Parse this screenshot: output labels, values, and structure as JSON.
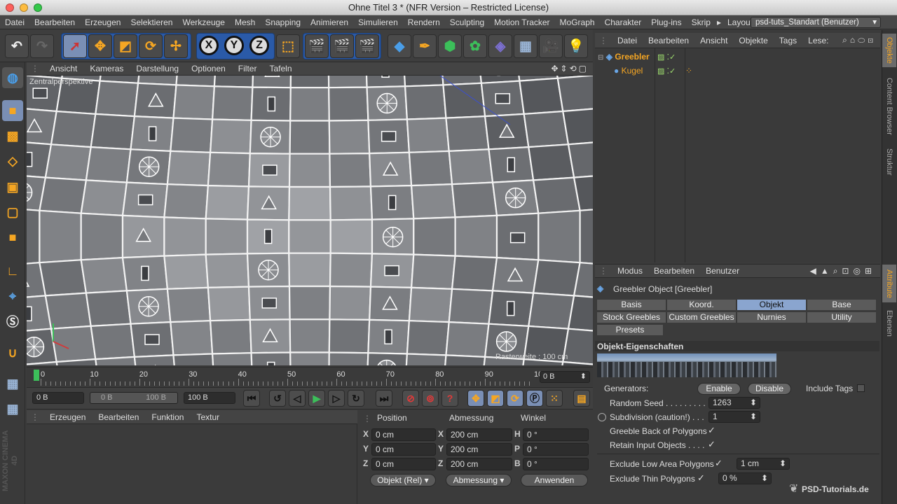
{
  "window": {
    "title": "Ohne Titel 3 * (NFR Version – Restricted License)"
  },
  "menu": [
    "Datei",
    "Bearbeiten",
    "Erzeugen",
    "Selektieren",
    "Werkzeuge",
    "Mesh",
    "Snapping",
    "Animieren",
    "Simulieren",
    "Rendern",
    "Sculpting",
    "Motion Tracker",
    "MoGraph",
    "Charakter",
    "Plug-ins",
    "Skrip"
  ],
  "layout": {
    "label": "Layout:",
    "value": "psd-tuts_Standart (Benutzer)"
  },
  "toolbar": {
    "x": "X",
    "y": "Y",
    "z": "Z"
  },
  "viewport": {
    "menu": [
      "Ansicht",
      "Kameras",
      "Darstellung",
      "Optionen",
      "Filter",
      "Tafeln"
    ],
    "camera": "Zentralperspektive",
    "raster": "Rasterweite : 100 cm"
  },
  "timeline": {
    "ticks": [
      "0",
      "10",
      "20",
      "30",
      "40",
      "50",
      "60",
      "70",
      "80",
      "90",
      "100"
    ],
    "current_frame": "0 B"
  },
  "transport": {
    "start": "0 B",
    "range_start": "0 B",
    "range_end": "100 B",
    "end": "100 B"
  },
  "material_panel": {
    "menu": [
      "Erzeugen",
      "Bearbeiten",
      "Funktion",
      "Textur"
    ]
  },
  "coords": {
    "headers": [
      "Position",
      "Abmessung",
      "Winkel"
    ],
    "rows": [
      {
        "a": "X",
        "pos": "0 cm",
        "b": "X",
        "size": "200 cm",
        "c": "H",
        "rot": "0 °"
      },
      {
        "a": "Y",
        "pos": "0 cm",
        "b": "Y",
        "size": "200 cm",
        "c": "P",
        "rot": "0 °"
      },
      {
        "a": "Z",
        "pos": "0 cm",
        "b": "Z",
        "size": "200 cm",
        "c": "B",
        "rot": "0 °"
      }
    ],
    "mode": "Objekt (Rel)",
    "size_mode": "Abmessung",
    "apply": "Anwenden"
  },
  "object_manager": {
    "menu": [
      "Datei",
      "Bearbeiten",
      "Ansicht",
      "Objekte",
      "Tags",
      "Lese:"
    ],
    "objects": [
      {
        "name": "Greebler"
      },
      {
        "name": "Kugel"
      }
    ]
  },
  "side_tabs": {
    "top": [
      "Objekte",
      "Content Browser",
      "Struktur"
    ],
    "bottom": [
      "Attribute",
      "Ebenen"
    ]
  },
  "attributes": {
    "menu": [
      "Modus",
      "Bearbeiten",
      "Benutzer"
    ],
    "object_title": "Greebler Object [Greebler]",
    "tabs_row1": [
      "Basis",
      "Koord.",
      "Objekt",
      "Base"
    ],
    "tabs_row2": [
      "Stock Greebles",
      "Custom Greebles",
      "Nurnies",
      "Utility"
    ],
    "tabs_row3": [
      "Presets"
    ],
    "section": "Objekt-Eigenschaften",
    "generators_label": "Generators:",
    "enable": "Enable",
    "disable": "Disable",
    "include_tags": "Include Tags",
    "random_seed_label": "Random Seed . . . . . . . . . .",
    "random_seed": "1263",
    "subdivision_label": "Subdivision (caution!) . . .",
    "subdivision": "1",
    "greeble_back": "Greeble Back of Polygons",
    "retain_input": "Retain Input Objects . . . .",
    "exclude_low": "Exclude Low Area Polygons",
    "exclude_low_val": "1 cm",
    "exclude_thin": "Exclude Thin Polygons",
    "exclude_thin_val": "0 %"
  },
  "watermark": "PSD-Tutorials.de",
  "branding": "MAXON CINEMA 4D"
}
